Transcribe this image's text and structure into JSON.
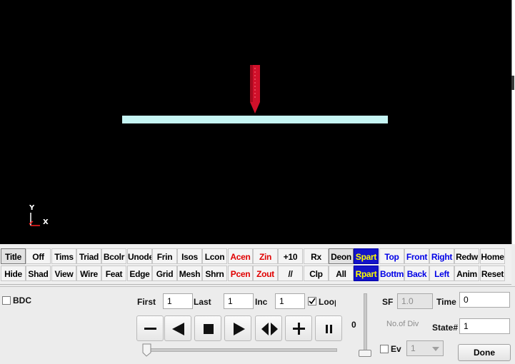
{
  "viewport": {
    "background": "#000000",
    "axis": {
      "y": "Y",
      "x": "X"
    },
    "plate_color": "#c6f5f4",
    "probe_color": "#d0102a"
  },
  "toolbar": {
    "row1": [
      {
        "label": "Title",
        "name": "title",
        "style": "pressed"
      },
      {
        "label": "Off",
        "name": "off",
        "style": ""
      },
      {
        "label": "Tims",
        "name": "tims",
        "style": ""
      },
      {
        "label": "Triad",
        "name": "triad",
        "style": ""
      },
      {
        "label": "Bcolr",
        "name": "bcolr",
        "style": ""
      },
      {
        "label": "Unode",
        "name": "unode",
        "style": ""
      },
      {
        "label": "Frin",
        "name": "frin",
        "style": ""
      },
      {
        "label": "Isos",
        "name": "isos",
        "style": ""
      },
      {
        "label": "Lcon",
        "name": "lcon",
        "style": ""
      },
      {
        "label": "Acen",
        "name": "acen",
        "style": "red"
      },
      {
        "label": "Zin",
        "name": "zin",
        "style": "red"
      },
      {
        "label": "+10",
        "name": "plus10",
        "style": ""
      },
      {
        "label": "Rx",
        "name": "rx",
        "style": ""
      },
      {
        "label": "Deon",
        "name": "deon",
        "style": "pressed"
      },
      {
        "label": "Spart",
        "name": "spart",
        "style": "hl"
      },
      {
        "label": "Top",
        "name": "top",
        "style": "blue"
      },
      {
        "label": "Front",
        "name": "front",
        "style": "blue"
      },
      {
        "label": "Right",
        "name": "right",
        "style": "blue"
      },
      {
        "label": "Redw",
        "name": "redw",
        "style": ""
      },
      {
        "label": "Home",
        "name": "home",
        "style": ""
      }
    ],
    "row2": [
      {
        "label": "Hide",
        "name": "hide",
        "style": ""
      },
      {
        "label": "Shad",
        "name": "shad",
        "style": ""
      },
      {
        "label": "View",
        "name": "view",
        "style": ""
      },
      {
        "label": "Wire",
        "name": "wire",
        "style": ""
      },
      {
        "label": "Feat",
        "name": "feat",
        "style": ""
      },
      {
        "label": "Edge",
        "name": "edge",
        "style": ""
      },
      {
        "label": "Grid",
        "name": "grid",
        "style": ""
      },
      {
        "label": "Mesh",
        "name": "mesh",
        "style": ""
      },
      {
        "label": "Shrn",
        "name": "shrn",
        "style": ""
      },
      {
        "label": "Pcen",
        "name": "pcen",
        "style": "red"
      },
      {
        "label": "Zout",
        "name": "zout",
        "style": "red"
      },
      {
        "label": "//",
        "name": "parallel",
        "style": ""
      },
      {
        "label": "Clp",
        "name": "clp",
        "style": ""
      },
      {
        "label": "All",
        "name": "all",
        "style": ""
      },
      {
        "label": "Rpart",
        "name": "rpart",
        "style": "hl"
      },
      {
        "label": "Bottm",
        "name": "bottm",
        "style": "blue"
      },
      {
        "label": "Back",
        "name": "back",
        "style": "blue"
      },
      {
        "label": "Left",
        "name": "left",
        "style": "blue"
      },
      {
        "label": "Anim",
        "name": "anim",
        "style": ""
      },
      {
        "label": "Reset",
        "name": "reset",
        "style": ""
      }
    ]
  },
  "controls": {
    "bdc_label": "BDC",
    "first_label": "First",
    "first_value": "1",
    "last_label": "Last",
    "last_value": "1",
    "inc_label": "Inc",
    "inc_value": "1",
    "loop_label": "Loop",
    "loop_checked": true,
    "speed_value": "0",
    "sf_label": "SF",
    "sf_value": "1.0",
    "time_label": "Time",
    "time_value": "0",
    "nodiv_label": "No.of Div",
    "state_label": "State#",
    "state_value": "1",
    "ev_label": "Ev",
    "ev_value": "1",
    "done_label": "Done",
    "playback": [
      "minus-icon",
      "step-back-icon",
      "stop-icon",
      "play-icon",
      "bounce-icon",
      "plus-icon",
      "pause-icon"
    ]
  }
}
